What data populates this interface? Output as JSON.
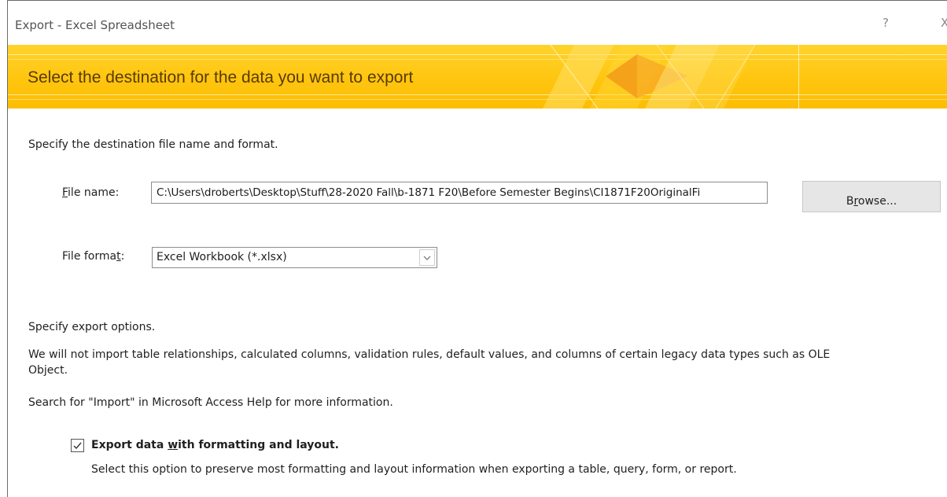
{
  "window": {
    "title": "Export - Excel Spreadsheet",
    "help_glyph": "?",
    "close_glyph": "X"
  },
  "banner": {
    "heading": "Select the destination for the data you want to export",
    "color": "#ffc50f"
  },
  "destination": {
    "intro": "Specify the destination file name and format.",
    "file_name_label_access": "F",
    "file_name_label_rest": "ile name:",
    "file_name_value": "C:\\Users\\droberts\\Desktop\\Stuff\\28-2020 Fall\\b-1871 F20\\Before Semester Begins\\CI1871F20OriginalFi",
    "browse_prefix": "B",
    "browse_access": "r",
    "browse_rest": "owse...",
    "file_format_label_pre": "File forma",
    "file_format_label_access": "t",
    "file_format_label_post": ":",
    "file_format_value": "Excel Workbook (*.xlsx)"
  },
  "options": {
    "intro": "Specify export options.",
    "note_line1": "We will not import table relationships, calculated columns, validation rules, default values, and columns of certain legacy data types such as OLE",
    "note_line2": "Object.",
    "help_text": "Search for \"Import\" in Microsoft Access Help for more information.",
    "checkbox_label_pre": "Export data ",
    "checkbox_label_access": "w",
    "checkbox_label_post": "ith formatting and layout.",
    "checkbox_checked": true,
    "checkbox_desc": "Select this option to preserve most formatting and layout information when exporting a table, query, form, or report."
  }
}
